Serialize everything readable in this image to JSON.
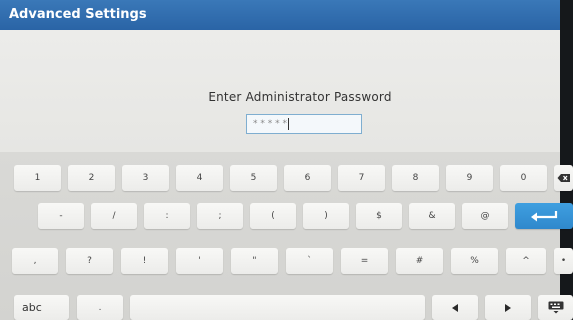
{
  "window": {
    "title": "Advanced Settings"
  },
  "dialog": {
    "prompt": "Enter Administrator Password",
    "password_mask": "* * * * *"
  },
  "keyboard": {
    "row1": [
      "1",
      "2",
      "3",
      "4",
      "5",
      "6",
      "7",
      "8",
      "9",
      "0"
    ],
    "row2": [
      "-",
      "/",
      ":",
      ";",
      "(",
      ")",
      "$",
      "&",
      "@"
    ],
    "row3": [
      ",",
      "?",
      "!",
      "'",
      "\"",
      "`",
      "=",
      "#",
      "%",
      "^",
      "•"
    ],
    "mode_key": "abc",
    "dot_key": ".",
    "icons": {
      "backspace": "backspace-icon",
      "enter": "enter-icon",
      "left": "arrow-left-icon",
      "right": "arrow-right-icon",
      "hide": "keyboard-hide-icon"
    },
    "accent_color": "#2f88cc"
  }
}
